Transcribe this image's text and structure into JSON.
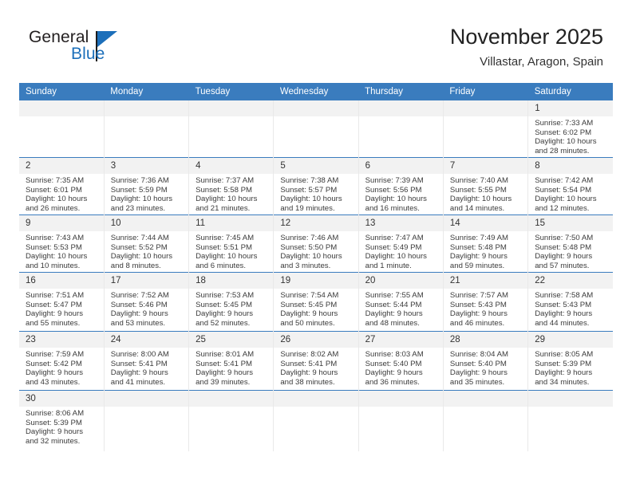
{
  "brand": {
    "word1": "General",
    "word2": "Blue",
    "logo_icon": "general-blue-flag-logo"
  },
  "header": {
    "month_year": "November 2025",
    "location": "Villastar, Aragon, Spain"
  },
  "colors": {
    "header_blue": "#3a7cbe",
    "brand_blue": "#1c6fba",
    "daynum_band": "#f2f2f2",
    "cell_divider": "#e9e9e9"
  },
  "weekday_headers": [
    "Sunday",
    "Monday",
    "Tuesday",
    "Wednesday",
    "Thursday",
    "Friday",
    "Saturday"
  ],
  "weeks": [
    [
      {
        "empty": true
      },
      {
        "empty": true
      },
      {
        "empty": true
      },
      {
        "empty": true
      },
      {
        "empty": true
      },
      {
        "empty": true
      },
      {
        "day": "1",
        "sunrise": "Sunrise: 7:33 AM",
        "sunset": "Sunset: 6:02 PM",
        "daylight1": "Daylight: 10 hours",
        "daylight2": "and 28 minutes."
      }
    ],
    [
      {
        "day": "2",
        "sunrise": "Sunrise: 7:35 AM",
        "sunset": "Sunset: 6:01 PM",
        "daylight1": "Daylight: 10 hours",
        "daylight2": "and 26 minutes."
      },
      {
        "day": "3",
        "sunrise": "Sunrise: 7:36 AM",
        "sunset": "Sunset: 5:59 PM",
        "daylight1": "Daylight: 10 hours",
        "daylight2": "and 23 minutes."
      },
      {
        "day": "4",
        "sunrise": "Sunrise: 7:37 AM",
        "sunset": "Sunset: 5:58 PM",
        "daylight1": "Daylight: 10 hours",
        "daylight2": "and 21 minutes."
      },
      {
        "day": "5",
        "sunrise": "Sunrise: 7:38 AM",
        "sunset": "Sunset: 5:57 PM",
        "daylight1": "Daylight: 10 hours",
        "daylight2": "and 19 minutes."
      },
      {
        "day": "6",
        "sunrise": "Sunrise: 7:39 AM",
        "sunset": "Sunset: 5:56 PM",
        "daylight1": "Daylight: 10 hours",
        "daylight2": "and 16 minutes."
      },
      {
        "day": "7",
        "sunrise": "Sunrise: 7:40 AM",
        "sunset": "Sunset: 5:55 PM",
        "daylight1": "Daylight: 10 hours",
        "daylight2": "and 14 minutes."
      },
      {
        "day": "8",
        "sunrise": "Sunrise: 7:42 AM",
        "sunset": "Sunset: 5:54 PM",
        "daylight1": "Daylight: 10 hours",
        "daylight2": "and 12 minutes."
      }
    ],
    [
      {
        "day": "9",
        "sunrise": "Sunrise: 7:43 AM",
        "sunset": "Sunset: 5:53 PM",
        "daylight1": "Daylight: 10 hours",
        "daylight2": "and 10 minutes."
      },
      {
        "day": "10",
        "sunrise": "Sunrise: 7:44 AM",
        "sunset": "Sunset: 5:52 PM",
        "daylight1": "Daylight: 10 hours",
        "daylight2": "and 8 minutes."
      },
      {
        "day": "11",
        "sunrise": "Sunrise: 7:45 AM",
        "sunset": "Sunset: 5:51 PM",
        "daylight1": "Daylight: 10 hours",
        "daylight2": "and 6 minutes."
      },
      {
        "day": "12",
        "sunrise": "Sunrise: 7:46 AM",
        "sunset": "Sunset: 5:50 PM",
        "daylight1": "Daylight: 10 hours",
        "daylight2": "and 3 minutes."
      },
      {
        "day": "13",
        "sunrise": "Sunrise: 7:47 AM",
        "sunset": "Sunset: 5:49 PM",
        "daylight1": "Daylight: 10 hours",
        "daylight2": "and 1 minute."
      },
      {
        "day": "14",
        "sunrise": "Sunrise: 7:49 AM",
        "sunset": "Sunset: 5:48 PM",
        "daylight1": "Daylight: 9 hours",
        "daylight2": "and 59 minutes."
      },
      {
        "day": "15",
        "sunrise": "Sunrise: 7:50 AM",
        "sunset": "Sunset: 5:48 PM",
        "daylight1": "Daylight: 9 hours",
        "daylight2": "and 57 minutes."
      }
    ],
    [
      {
        "day": "16",
        "sunrise": "Sunrise: 7:51 AM",
        "sunset": "Sunset: 5:47 PM",
        "daylight1": "Daylight: 9 hours",
        "daylight2": "and 55 minutes."
      },
      {
        "day": "17",
        "sunrise": "Sunrise: 7:52 AM",
        "sunset": "Sunset: 5:46 PM",
        "daylight1": "Daylight: 9 hours",
        "daylight2": "and 53 minutes."
      },
      {
        "day": "18",
        "sunrise": "Sunrise: 7:53 AM",
        "sunset": "Sunset: 5:45 PM",
        "daylight1": "Daylight: 9 hours",
        "daylight2": "and 52 minutes."
      },
      {
        "day": "19",
        "sunrise": "Sunrise: 7:54 AM",
        "sunset": "Sunset: 5:45 PM",
        "daylight1": "Daylight: 9 hours",
        "daylight2": "and 50 minutes."
      },
      {
        "day": "20",
        "sunrise": "Sunrise: 7:55 AM",
        "sunset": "Sunset: 5:44 PM",
        "daylight1": "Daylight: 9 hours",
        "daylight2": "and 48 minutes."
      },
      {
        "day": "21",
        "sunrise": "Sunrise: 7:57 AM",
        "sunset": "Sunset: 5:43 PM",
        "daylight1": "Daylight: 9 hours",
        "daylight2": "and 46 minutes."
      },
      {
        "day": "22",
        "sunrise": "Sunrise: 7:58 AM",
        "sunset": "Sunset: 5:43 PM",
        "daylight1": "Daylight: 9 hours",
        "daylight2": "and 44 minutes."
      }
    ],
    [
      {
        "day": "23",
        "sunrise": "Sunrise: 7:59 AM",
        "sunset": "Sunset: 5:42 PM",
        "daylight1": "Daylight: 9 hours",
        "daylight2": "and 43 minutes."
      },
      {
        "day": "24",
        "sunrise": "Sunrise: 8:00 AM",
        "sunset": "Sunset: 5:41 PM",
        "daylight1": "Daylight: 9 hours",
        "daylight2": "and 41 minutes."
      },
      {
        "day": "25",
        "sunrise": "Sunrise: 8:01 AM",
        "sunset": "Sunset: 5:41 PM",
        "daylight1": "Daylight: 9 hours",
        "daylight2": "and 39 minutes."
      },
      {
        "day": "26",
        "sunrise": "Sunrise: 8:02 AM",
        "sunset": "Sunset: 5:41 PM",
        "daylight1": "Daylight: 9 hours",
        "daylight2": "and 38 minutes."
      },
      {
        "day": "27",
        "sunrise": "Sunrise: 8:03 AM",
        "sunset": "Sunset: 5:40 PM",
        "daylight1": "Daylight: 9 hours",
        "daylight2": "and 36 minutes."
      },
      {
        "day": "28",
        "sunrise": "Sunrise: 8:04 AM",
        "sunset": "Sunset: 5:40 PM",
        "daylight1": "Daylight: 9 hours",
        "daylight2": "and 35 minutes."
      },
      {
        "day": "29",
        "sunrise": "Sunrise: 8:05 AM",
        "sunset": "Sunset: 5:39 PM",
        "daylight1": "Daylight: 9 hours",
        "daylight2": "and 34 minutes."
      }
    ],
    [
      {
        "day": "30",
        "sunrise": "Sunrise: 8:06 AM",
        "sunset": "Sunset: 5:39 PM",
        "daylight1": "Daylight: 9 hours",
        "daylight2": "and 32 minutes."
      },
      {
        "empty": true
      },
      {
        "empty": true
      },
      {
        "empty": true
      },
      {
        "empty": true
      },
      {
        "empty": true
      },
      {
        "empty": true
      }
    ]
  ]
}
